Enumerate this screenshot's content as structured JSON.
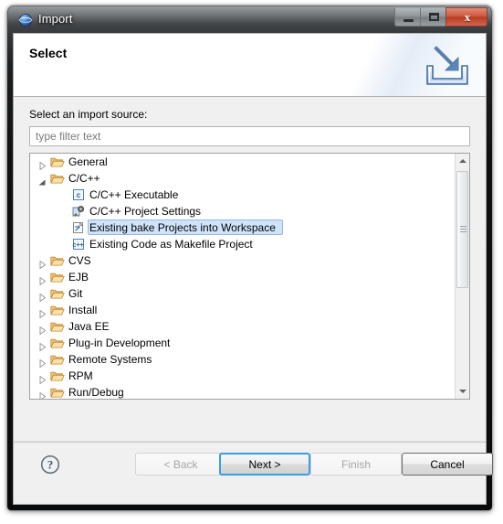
{
  "window": {
    "title": "Import",
    "app_icon": "eclipse-globe-icon",
    "controls": {
      "minimize": "minimize-button",
      "maximize": "maximize-button",
      "close_label": "x"
    }
  },
  "banner": {
    "title": "Select",
    "icon": "import-arrow-into-tray-icon"
  },
  "body": {
    "source_label": "Select an import source:",
    "filter": {
      "value": "",
      "placeholder": "type filter text"
    }
  },
  "tree": {
    "rows": [
      {
        "label": "General",
        "depth": 0,
        "icon": "folder-icon",
        "twisty": "collapsed",
        "selected": false
      },
      {
        "label": "C/C++",
        "depth": 0,
        "icon": "folder-icon",
        "twisty": "expanded",
        "selected": false
      },
      {
        "label": "C/C++ Executable",
        "depth": 1,
        "icon": "c-executable-icon",
        "twisty": "none",
        "selected": false
      },
      {
        "label": "C/C++ Project Settings",
        "depth": 1,
        "icon": "project-settings-icon",
        "twisty": "none",
        "selected": false
      },
      {
        "label": "Existing bake Projects into Workspace",
        "depth": 1,
        "icon": "bake-project-icon",
        "twisty": "none",
        "selected": true
      },
      {
        "label": "Existing Code as Makefile Project",
        "depth": 1,
        "icon": "cpp-makefile-icon",
        "twisty": "none",
        "selected": false
      },
      {
        "label": "CVS",
        "depth": 0,
        "icon": "folder-icon",
        "twisty": "collapsed",
        "selected": false
      },
      {
        "label": "EJB",
        "depth": 0,
        "icon": "folder-icon",
        "twisty": "collapsed",
        "selected": false
      },
      {
        "label": "Git",
        "depth": 0,
        "icon": "folder-icon",
        "twisty": "collapsed",
        "selected": false
      },
      {
        "label": "Install",
        "depth": 0,
        "icon": "folder-icon",
        "twisty": "collapsed",
        "selected": false
      },
      {
        "label": "Java EE",
        "depth": 0,
        "icon": "folder-icon",
        "twisty": "collapsed",
        "selected": false
      },
      {
        "label": "Plug-in Development",
        "depth": 0,
        "icon": "folder-icon",
        "twisty": "collapsed",
        "selected": false
      },
      {
        "label": "Remote Systems",
        "depth": 0,
        "icon": "folder-icon",
        "twisty": "collapsed",
        "selected": false
      },
      {
        "label": "RPM",
        "depth": 0,
        "icon": "folder-icon",
        "twisty": "collapsed",
        "selected": false
      },
      {
        "label": "Run/Debug",
        "depth": 0,
        "icon": "folder-icon",
        "twisty": "collapsed",
        "selected": false
      }
    ],
    "scrollbar": {
      "orientation": "vertical",
      "thumb_position": "top"
    }
  },
  "buttons": {
    "help": "help-icon",
    "back": {
      "label": "< Back",
      "enabled": false
    },
    "next": {
      "label": "Next >",
      "enabled": true,
      "default": true
    },
    "finish": {
      "label": "Finish",
      "enabled": false
    },
    "cancel": {
      "label": "Cancel",
      "enabled": true
    }
  },
  "colors": {
    "selection_fill": "#cfe4fb",
    "selection_border": "#94b8e0",
    "default_button_focus": "#3c9ddf",
    "close_button": "#cf5a40",
    "dialog_background": "#f0f0f0"
  }
}
